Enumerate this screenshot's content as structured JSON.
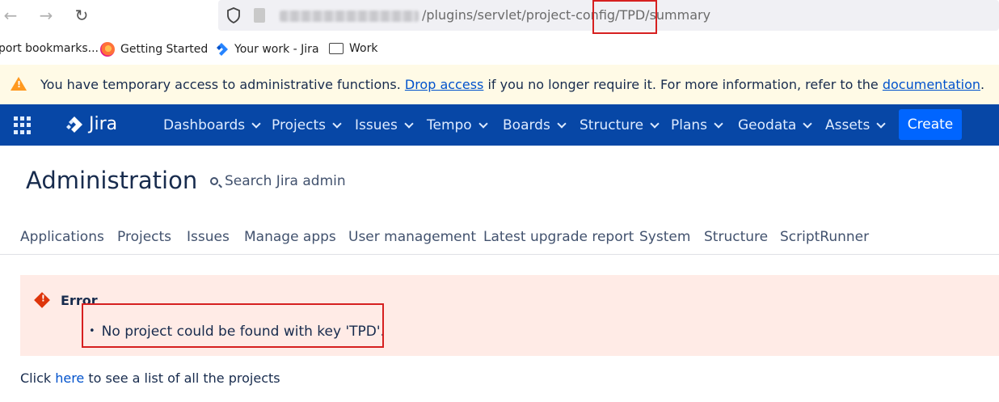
{
  "browser": {
    "back_icon": "arrow-left-icon",
    "forward_icon": "arrow-right-icon",
    "reload_icon": "reload-icon",
    "url_visible": "/plugins/servlet/project-config/TPD/summary"
  },
  "bookmarks": [
    {
      "label": "port bookmarks...",
      "icon": ""
    },
    {
      "label": "Getting Started",
      "icon": "firefox-icon"
    },
    {
      "label": "Your work - Jira",
      "icon": "jira-icon"
    },
    {
      "label": "Work",
      "icon": "folder-icon"
    }
  ],
  "warning": {
    "before": "You have temporary access to administrative functions. ",
    "link1": "Drop access",
    "middle": " if you no longer require it. For more information, refer to the ",
    "link2": "documentation",
    "after": "."
  },
  "topnav": {
    "logo": "Jira",
    "items": [
      "Dashboards",
      "Projects",
      "Issues",
      "Tempo",
      "Boards",
      "Structure",
      "Plans",
      "Geodata",
      "Assets"
    ],
    "create": "Create",
    "brand_color": "#0747a6"
  },
  "admin": {
    "title": "Administration",
    "search": "Search Jira admin",
    "tabs": [
      "Applications",
      "Projects",
      "Issues",
      "Manage apps",
      "User management",
      "Latest upgrade report",
      "System",
      "Structure",
      "ScriptRunner"
    ]
  },
  "error": {
    "title": "Error",
    "message": "No project could be found with key 'TPD'."
  },
  "footer": {
    "before": "Click ",
    "link": "here",
    "after": " to see a list of all the projects"
  }
}
